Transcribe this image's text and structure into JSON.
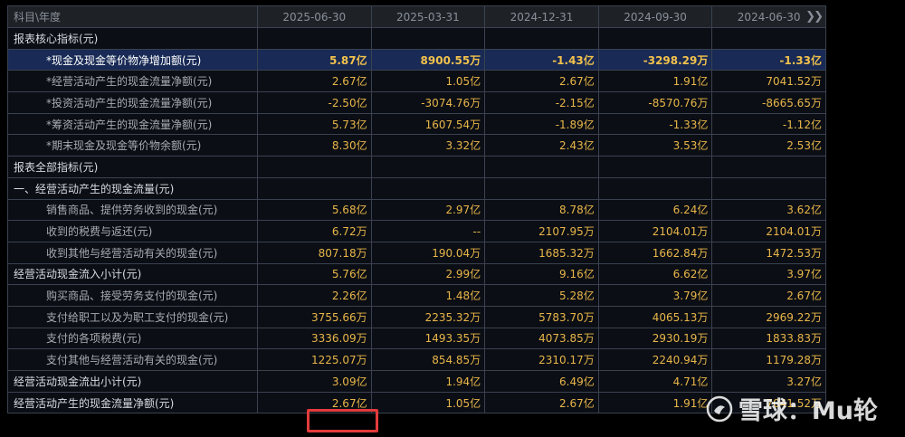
{
  "header": {
    "label_col": "科目\\年度",
    "periods": [
      "2025-06-30",
      "2025-03-31",
      "2024-12-31",
      "2024-09-30",
      "2024-06-30"
    ],
    "more_icon": "double-chevron-right-icon"
  },
  "rows": [
    {
      "label": "报表核心指标(元)",
      "type": "section",
      "values": [
        "",
        "",
        "",
        "",
        ""
      ]
    },
    {
      "label": "*现金及现金等价物净增加额(元)",
      "type": "highlight",
      "values": [
        "5.87亿",
        "8900.55万",
        "-1.43亿",
        "-3298.29万",
        "-1.33亿"
      ]
    },
    {
      "label": "*经营活动产生的现金流量净额(元)",
      "type": "sub",
      "values": [
        "2.67亿",
        "1.05亿",
        "2.67亿",
        "1.91亿",
        "7041.52万"
      ]
    },
    {
      "label": "*投资活动产生的现金流量净额(元)",
      "type": "sub",
      "values": [
        "-2.50亿",
        "-3074.76万",
        "-2.15亿",
        "-8570.76万",
        "-8665.65万"
      ]
    },
    {
      "label": "*筹资活动产生的现金流量净额(元)",
      "type": "sub",
      "values": [
        "5.73亿",
        "1607.54万",
        "-1.89亿",
        "-1.33亿",
        "-1.12亿"
      ]
    },
    {
      "label": "*期末现金及现金等价物余额(元)",
      "type": "sub",
      "values": [
        "8.30亿",
        "3.32亿",
        "2.43亿",
        "3.53亿",
        "2.53亿"
      ]
    },
    {
      "label": "报表全部指标(元)",
      "type": "section",
      "values": [
        "",
        "",
        "",
        "",
        ""
      ]
    },
    {
      "label": "一、经营活动产生的现金流量(元)",
      "type": "section",
      "values": [
        "",
        "",
        "",
        "",
        ""
      ]
    },
    {
      "label": "销售商品、提供劳务收到的现金(元)",
      "type": "sub",
      "values": [
        "5.68亿",
        "2.97亿",
        "8.78亿",
        "6.24亿",
        "3.62亿"
      ]
    },
    {
      "label": "收到的税费与返还(元)",
      "type": "sub",
      "values": [
        "6.72万",
        "--",
        "2107.95万",
        "2104.01万",
        "2104.01万"
      ]
    },
    {
      "label": "收到其他与经营活动有关的现金(元)",
      "type": "sub",
      "values": [
        "807.18万",
        "190.04万",
        "1685.32万",
        "1662.84万",
        "1472.53万"
      ]
    },
    {
      "label": "经营活动现金流入小计(元)",
      "type": "major",
      "values": [
        "5.76亿",
        "2.99亿",
        "9.16亿",
        "6.62亿",
        "3.97亿"
      ]
    },
    {
      "label": "购买商品、接受劳务支付的现金(元)",
      "type": "sub",
      "values": [
        "2.26亿",
        "1.48亿",
        "5.28亿",
        "3.79亿",
        "2.67亿"
      ]
    },
    {
      "label": "支付给职工以及为职工支付的现金(元)",
      "type": "sub",
      "values": [
        "3755.66万",
        "2235.32万",
        "5783.70万",
        "4065.13万",
        "2969.22万"
      ]
    },
    {
      "label": "支付的各项税费(元)",
      "type": "sub",
      "values": [
        "3336.09万",
        "1493.35万",
        "4073.85万",
        "2930.19万",
        "1833.83万"
      ]
    },
    {
      "label": "支付其他与经营活动有关的现金(元)",
      "type": "sub",
      "values": [
        "1225.07万",
        "854.85万",
        "2310.17万",
        "2240.94万",
        "1179.28万"
      ]
    },
    {
      "label": "经营活动现金流出小计(元)",
      "type": "major",
      "values": [
        "3.09亿",
        "1.94亿",
        "6.49亿",
        "4.71亿",
        "3.27亿"
      ]
    },
    {
      "label": "经营活动产生的现金流量净额(元)",
      "type": "major",
      "values": [
        "2.67亿",
        "1.05亿",
        "2.67亿",
        "1.91亿",
        "7041.52万"
      ]
    }
  ],
  "watermark": {
    "text": "雪球：Mu轮",
    "logo_icon": "snowball-logo-icon"
  },
  "colors": {
    "background": "#000000",
    "value_text": "#e8b64a",
    "highlight_row": "#182a55",
    "annotation_box": "#e23b3b"
  }
}
